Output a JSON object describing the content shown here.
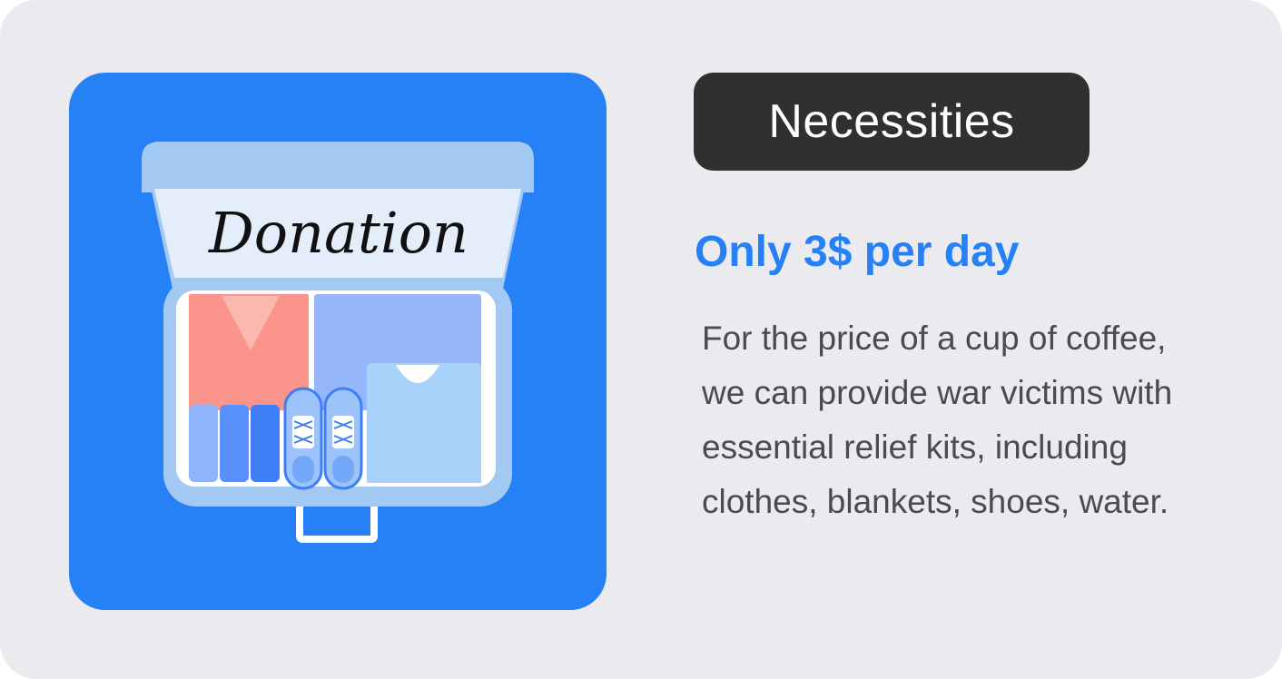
{
  "illustration": {
    "box_label": "Donation"
  },
  "tag": {
    "label": "Necessities"
  },
  "headline": "Only 3$ per day",
  "description": {
    "lines": [
      "For the price of a cup of coffee,",
      "we can provide war victims with",
      "essential relief kits, including",
      "clothes, blankets, shoes, water."
    ]
  },
  "colors": {
    "background": "#ebeaef",
    "accent": "#2680f6",
    "tag_background": "#303030",
    "body_text": "#4b4b4f"
  }
}
